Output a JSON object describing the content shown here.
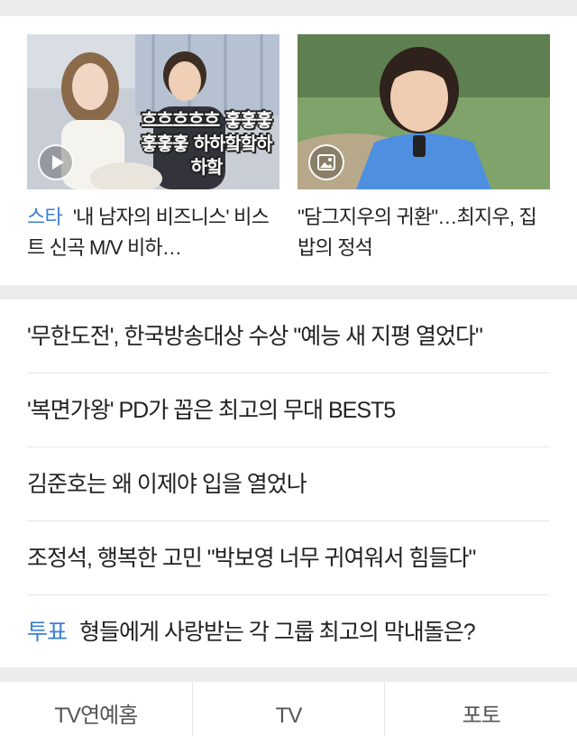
{
  "top_cards": [
    {
      "tag": "스타",
      "title": "'내 남자의 비즈니스' 비스트 신곡 M/V 비하…",
      "overlay_text": "흐흐흐흐흐 훟훟훟훟훟훟 하하핰핰하하핰",
      "media_icon": "play-icon"
    },
    {
      "tag": "",
      "title": "\"담그지우의 귀환\"…최지우, 집밥의 정석",
      "media_icon": "photo-icon"
    }
  ],
  "headlines": [
    {
      "tag": "",
      "title": "'무한도전', 한국방송대상 수상 \"예능 새 지평 열었다\""
    },
    {
      "tag": "",
      "title": "'복면가왕' PD가 꼽은 최고의 무대 BEST5"
    },
    {
      "tag": "",
      "title": "김준호는 왜 이제야 입을 열었나"
    },
    {
      "tag": "",
      "title": "조정석, 행복한 고민 \"박보영 너무 귀여워서 힘들다\""
    },
    {
      "tag": "투표",
      "title": "형들에게 사랑받는 각 그룹 최고의 막내돌은?"
    }
  ],
  "bottom_tabs": [
    "TV연예홈",
    "TV",
    "포토"
  ],
  "colors": {
    "tag": "#3b80d6",
    "background": "#ececec"
  }
}
